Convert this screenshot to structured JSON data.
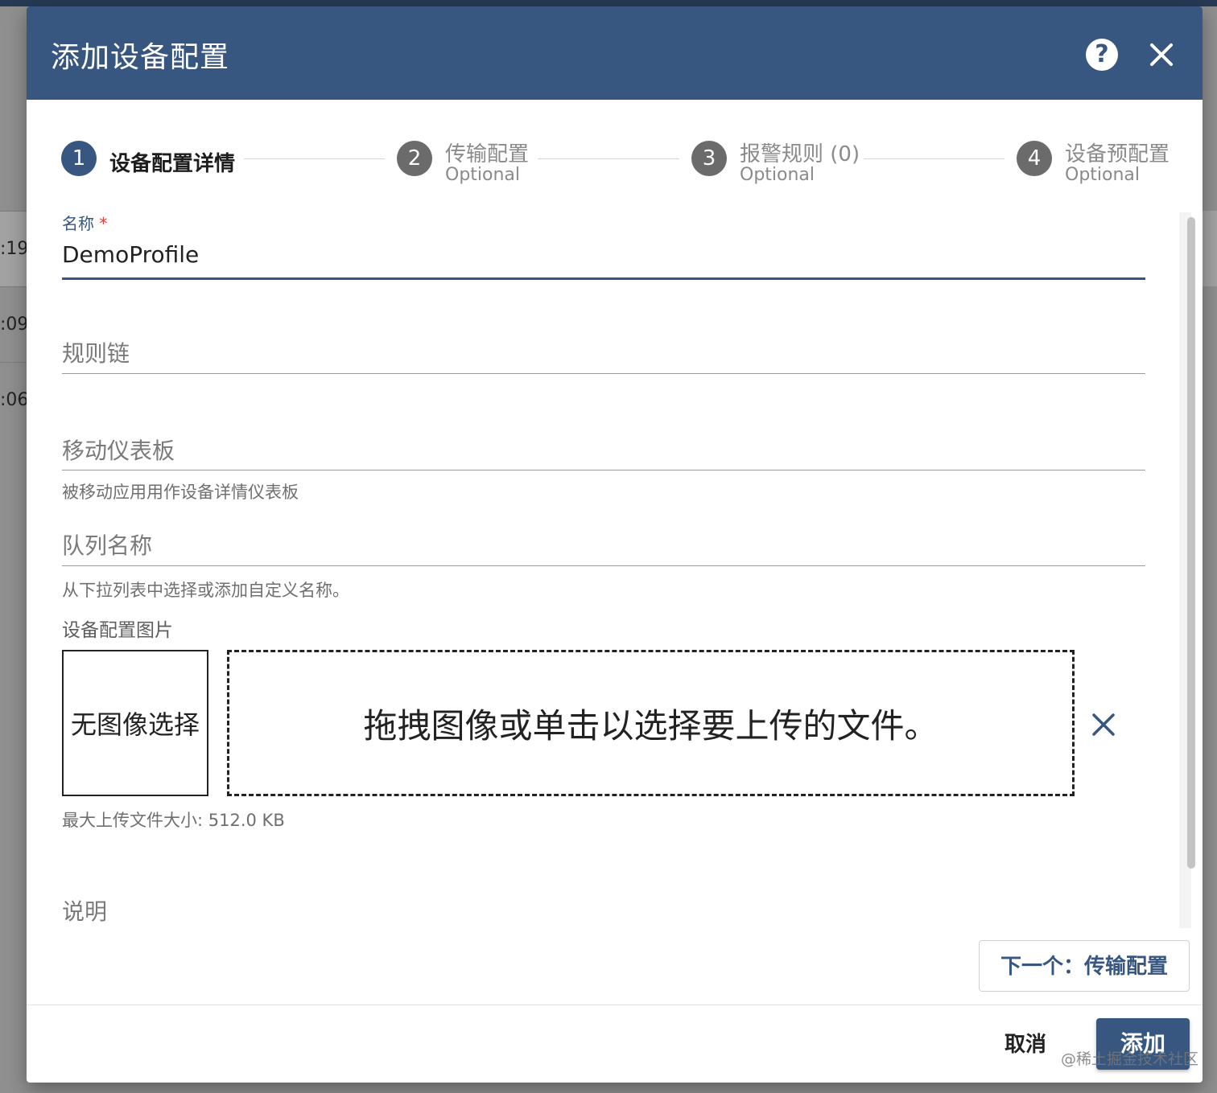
{
  "background": {
    "row_times": [
      ":19",
      ":09",
      ":06"
    ]
  },
  "dialog": {
    "title": "添加设备配置",
    "help_icon": "help-circle-icon",
    "close_icon": "close-icon"
  },
  "stepper": {
    "steps": [
      {
        "number": "1",
        "label": "设备配置详情",
        "optional": "",
        "state": "active"
      },
      {
        "number": "2",
        "label": "传输配置",
        "optional": "Optional",
        "state": "idle"
      },
      {
        "number": "3",
        "label": "报警规则 (0)",
        "optional": "Optional",
        "state": "idle"
      },
      {
        "number": "4",
        "label": "设备预配置",
        "optional": "Optional",
        "state": "idle"
      }
    ]
  },
  "form": {
    "name": {
      "label": "名称",
      "required_mark": "*",
      "value": "DemoProfile"
    },
    "rule_chain": {
      "placeholder": "规则链"
    },
    "mobile_dashboard": {
      "placeholder": "移动仪表板",
      "hint": "被移动应用用作设备详情仪表板"
    },
    "queue_name": {
      "placeholder": "队列名称",
      "hint": "从下拉列表中选择或添加自定义名称。"
    },
    "image": {
      "label": "设备配置图片",
      "no_image_text": "无图像选择",
      "drop_text": "拖拽图像或单击以选择要上传的文件。",
      "max_size_hint": "最大上传文件大小: 512.0 KB"
    },
    "description": {
      "placeholder": "说明"
    }
  },
  "buttons": {
    "next": "下一个：传输配置",
    "cancel": "取消",
    "add": "添加"
  },
  "watermark": "@稀土掘金技术社区",
  "colors": {
    "header": "#375680",
    "accent": "#375680",
    "required": "#e53935"
  }
}
